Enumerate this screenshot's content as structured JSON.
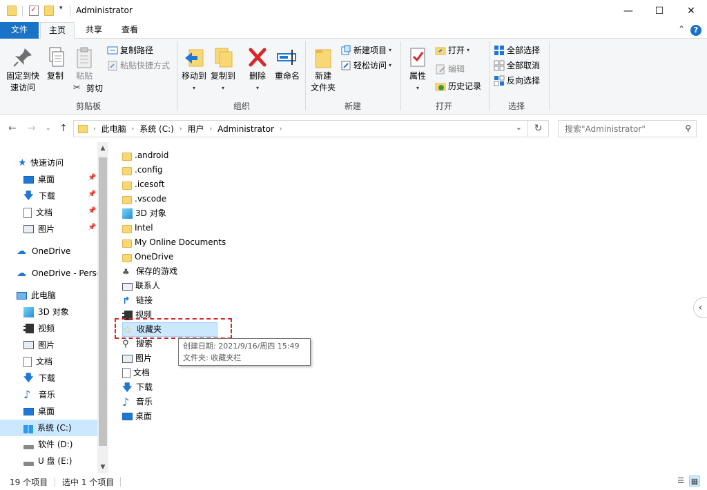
{
  "window": {
    "title": "Administrator",
    "minimize": "—",
    "maximize": "☐",
    "close": "✕"
  },
  "ribbon_tabs": {
    "file": "文件",
    "home": "主页",
    "share": "共享",
    "view": "查看",
    "help": "?"
  },
  "ribbon": {
    "clipboard": {
      "pin_line1": "固定到快",
      "pin_line2": "速访问",
      "copy": "复制",
      "paste": "粘贴",
      "copy_path": "复制路径",
      "paste_shortcut": "粘贴快捷方式",
      "cut": "剪切",
      "label": "剪贴板"
    },
    "organize": {
      "move_to": "移动到",
      "copy_to": "复制到",
      "delete": "删除",
      "rename": "重命名",
      "label": "组织"
    },
    "new": {
      "new_folder_line1": "新建",
      "new_folder_line2": "文件夹",
      "new_item": "新建项目",
      "easy_access": "轻松访问",
      "label": "新建"
    },
    "open": {
      "properties": "属性",
      "open": "打开",
      "edit": "编辑",
      "history": "历史记录",
      "label": "打开"
    },
    "select": {
      "select_all": "全部选择",
      "select_none": "全部取消",
      "invert": "反向选择",
      "label": "选择"
    }
  },
  "address": {
    "crumbs": [
      "此电脑",
      "系统 (C:)",
      "用户",
      "Administrator"
    ],
    "search_placeholder": "搜索\"Administrator\""
  },
  "nav_pane": {
    "quick_access": "快速访问",
    "qa_desktop": "桌面",
    "qa_downloads": "下载",
    "qa_documents": "文档",
    "qa_pictures": "图片",
    "onedrive": "OneDrive",
    "onedrive_personal": "OneDrive - Perso",
    "this_pc": "此电脑",
    "pc_3d": "3D 对象",
    "pc_video": "视频",
    "pc_pictures": "图片",
    "pc_documents": "文档",
    "pc_downloads": "下载",
    "pc_music": "音乐",
    "pc_desktop": "桌面",
    "drive_c": "系统 (C:)",
    "drive_d": "软件 (D:)",
    "drive_e": "U 盘 (E:)"
  },
  "files": [
    ".android",
    ".config",
    ".icesoft",
    ".vscode",
    "3D 对象",
    "Intel",
    "My Online Documents",
    "OneDrive",
    "保存的游戏",
    "联系人",
    "链接",
    "视频",
    "收藏夹",
    "搜索",
    "图片",
    "文档",
    "下载",
    "音乐",
    "桌面"
  ],
  "tooltip": {
    "line1": "创建日期: 2021/9/16/周四 15:49",
    "line2": "文件夹: 收藏夹栏"
  },
  "status": {
    "count": "19 个项目",
    "selected": "选中 1 个项目"
  }
}
